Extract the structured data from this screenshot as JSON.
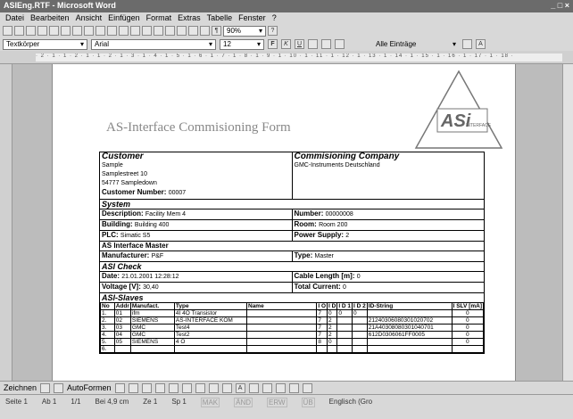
{
  "window": {
    "title": "ASIEng.RTF - Microsoft Word",
    "controls": "_ □ ×"
  },
  "menu": [
    "Datei",
    "Bearbeiten",
    "Ansicht",
    "Einfügen",
    "Format",
    "Extras",
    "Tabelle",
    "Fenster",
    "?"
  ],
  "toolbar": {
    "zoom": "90%"
  },
  "format_bar": {
    "style": "Textkörper",
    "font": "Arial",
    "size": "12",
    "bold": "F",
    "italic": "K",
    "underline": "U",
    "all_entries": "Alle Einträge"
  },
  "ruler_text": "· 2 · 1 · 1 · 2 · 1 · 1 · 2 · 1 · 3 · 1 · 4 · 1 · 5 · 1 · 6 · 1 · 7 · 1 · 8 · 1 · 9 · 1 · 10 · 1 · 11 · 1 · 12 · 1 · 13 · 1 · 14 · 1 · 15 · 1 · 16 · 1 · 17 · 1 · 18 ·",
  "doc": {
    "form_title": "AS-Interface Commisioning Form",
    "logo_text": "ASi",
    "logo_sub": "INTERFACE",
    "customer": {
      "heading": "Customer",
      "name": "Sample",
      "street": "Samplestreet 10",
      "city": "54777  Sampledown",
      "number_label": "Customer Number:",
      "number_value": "00007"
    },
    "company": {
      "heading": "Commisioning Company",
      "name": "GMC-Instruments Deutschland"
    },
    "system": {
      "heading": "System",
      "description_label": "Description:",
      "description_value": "Facility Mem 4",
      "number_label": "Number:",
      "number_value": "00000008",
      "building_label": "Building:",
      "building_value": "Building 400",
      "room_label": "Room:",
      "room_value": "Room 200",
      "plc_label": "PLC:",
      "plc_value": "Simatic S5",
      "power_label": "Power Supply:",
      "power_value": "2"
    },
    "master": {
      "heading": "AS Interface Master",
      "manufacturer_label": "Manufacturer:",
      "manufacturer_value": "P&F",
      "type_label": "Type:",
      "type_value": "Master"
    },
    "check": {
      "heading": "ASI Check",
      "date_label": "Date:",
      "date_value": "21.01.2001 12:28:12",
      "cable_label": "Cable Length [m]:",
      "cable_value": "0",
      "voltage_label": "Voltage [V]:",
      "voltage_value": "30,40",
      "current_label": "Total Current:",
      "current_value": "0"
    },
    "slaves": {
      "heading": "ASI-Slaves",
      "columns": [
        "No",
        "Addr",
        "Manufact.",
        "Type",
        "Name",
        "I O",
        "I D",
        "I D 1",
        "I D 2",
        "ID-String",
        "I SLV [mA]"
      ],
      "rows": [
        [
          "1.",
          "01",
          "ifm",
          "4I 4O Transistor",
          "",
          "7",
          "0",
          "0",
          "0",
          "",
          "0"
        ],
        [
          "2.",
          "02",
          "SIEMENS",
          "AS-INTERFACE KOM",
          "",
          "7",
          "2",
          "",
          "",
          "21240306080301020702",
          "0"
        ],
        [
          "3.",
          "03",
          "GMC",
          "Test4",
          "",
          "7",
          "2",
          "",
          "",
          "21A40308080301040701",
          "0"
        ],
        [
          "4.",
          "04",
          "GMC",
          "Test2",
          "",
          "7",
          "2",
          "",
          "",
          "612D0306061FF0005",
          "0"
        ],
        [
          "5.",
          "05",
          "SIEMENS",
          "4 O",
          "",
          "8",
          "0",
          "",
          "",
          "",
          "0"
        ],
        [
          "6.",
          "",
          "",
          "",
          "",
          "",
          "",
          "",
          "",
          "",
          ""
        ]
      ]
    }
  },
  "drawbar": {
    "draw": "Zeichnen",
    "autoshapes": "AutoFormen"
  },
  "status": {
    "page": "Seite 1",
    "section": "Ab 1",
    "pages": "1/1",
    "pos": "Bei 4,9 cm",
    "line": "Ze 1",
    "col": "Sp 1",
    "mak": "MAK",
    "aend": "ÄND",
    "erw": "ERW",
    "ub": "ÜB",
    "lang": "Englisch (Gro"
  }
}
